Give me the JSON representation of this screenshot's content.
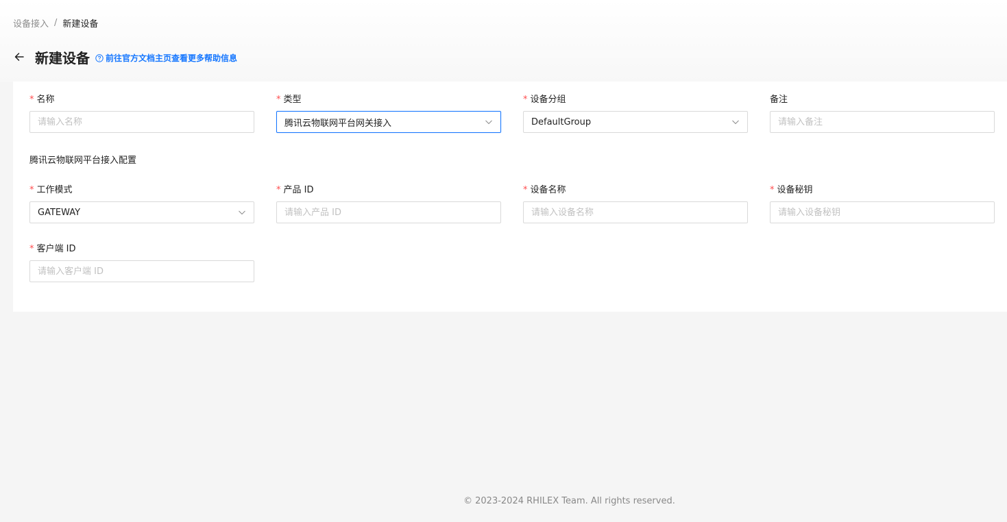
{
  "breadcrumb": {
    "parent": "设备接入",
    "separator": "/",
    "current": "新建设备"
  },
  "header": {
    "title": "新建设备",
    "help_link": "前往官方文档主页查看更多帮助信息",
    "back_icon": "arrow-left-icon",
    "help_icon": "question-circle-icon"
  },
  "form": {
    "name": {
      "label": "名称",
      "required": "*",
      "placeholder": "请输入名称",
      "value": ""
    },
    "type": {
      "label": "类型",
      "required": "*",
      "value": "腾讯云物联网平台网关接入"
    },
    "group": {
      "label": "设备分组",
      "required": "*",
      "value": "DefaultGroup"
    },
    "remark": {
      "label": "备注",
      "placeholder": "请输入备注",
      "value": ""
    },
    "section_title": "腾讯云物联网平台接入配置",
    "mode": {
      "label": "工作模式",
      "required": "*",
      "value": "GATEWAY"
    },
    "product_id": {
      "label": "产品 ID",
      "required": "*",
      "placeholder": "请输入产品 ID",
      "value": ""
    },
    "device_name": {
      "label": "设备名称",
      "required": "*",
      "placeholder": "请输入设备名称",
      "value": ""
    },
    "device_secret": {
      "label": "设备秘钥",
      "required": "*",
      "placeholder": "请输入设备秘钥",
      "value": ""
    },
    "client_id": {
      "label": "客户端 ID",
      "required": "*",
      "placeholder": "请输入客户端 ID",
      "value": ""
    }
  },
  "footer": {
    "copyright_symbol": "©",
    "text": "2023-2024 RHILEX Team. All rights reserved."
  },
  "colors": {
    "primary": "#1677ff",
    "required": "#ff4d4f",
    "background": "#f5f5f5",
    "card": "#ffffff"
  }
}
